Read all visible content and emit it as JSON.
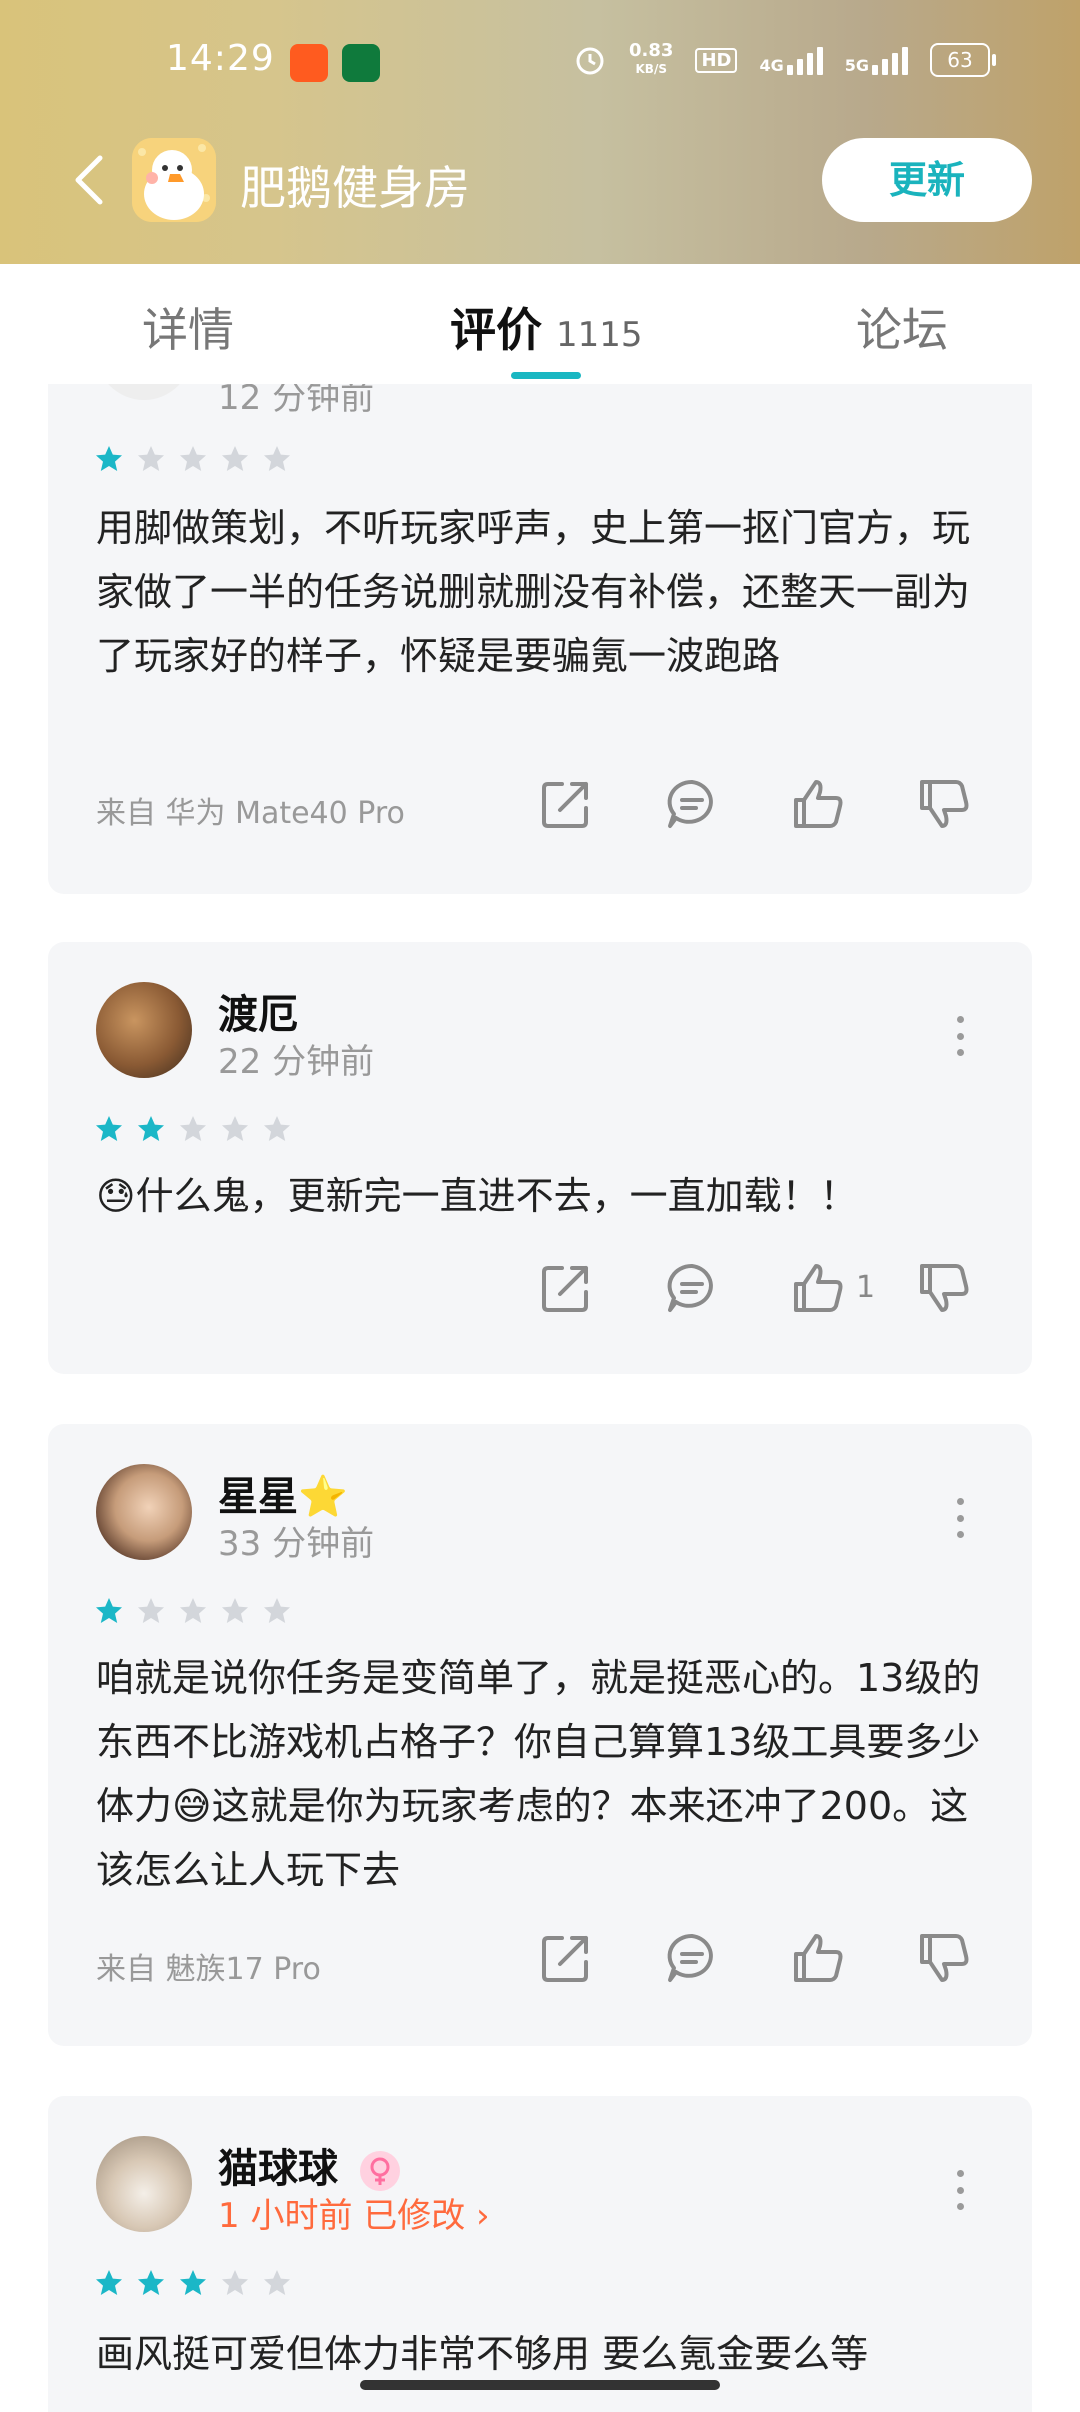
{
  "status_bar": {
    "time": "14:29",
    "net_speed": "0.83",
    "net_unit": "KB/S",
    "hd_label": "HD",
    "sim1": "4G",
    "sim2": "5G",
    "battery": "63"
  },
  "app": {
    "title": "肥鹅健身房",
    "update_label": "更新"
  },
  "tabs": {
    "details": "详情",
    "reviews": "评价",
    "reviews_count": "1115",
    "forum": "论坛"
  },
  "reviews": [
    {
      "time": "12 分钟前",
      "rating": 1,
      "text": "用脚做策划，不听玩家呼声，史上第一抠门官方，玩家做了一半的任务说删就删没有补偿，还整天一副为了玩家好的样子，怀疑是要骗氪一波跑路",
      "device": "来自 华为 Mate40 Pro"
    },
    {
      "name": "渡厄",
      "time": "22 分钟前",
      "rating": 2,
      "text": "😓什么鬼，更新完一直进不去，一直加载！！",
      "like_count": "1"
    },
    {
      "name": "星星⭐",
      "time": "33 分钟前",
      "rating": 1,
      "text": "咱就是说你任务是变简单了，就是挺恶心的。13级的东西不比游戏机占格子？你自己算算13级工具要多少体力😅这就是你为玩家考虑的？本来还冲了200。这该怎么让人玩下去",
      "device": "来自 魅族17 Pro"
    },
    {
      "name": "猫球球",
      "time": "1 小时前 已修改 ›",
      "rating": 3,
      "text": "画风挺可爱但体力非常不够用 要么氪金要么等"
    }
  ],
  "colors": {
    "accent": "#19b7c2",
    "star_on": "#1bb7c7",
    "star_off": "#d3d6db",
    "orange": "#ff6a3d"
  }
}
